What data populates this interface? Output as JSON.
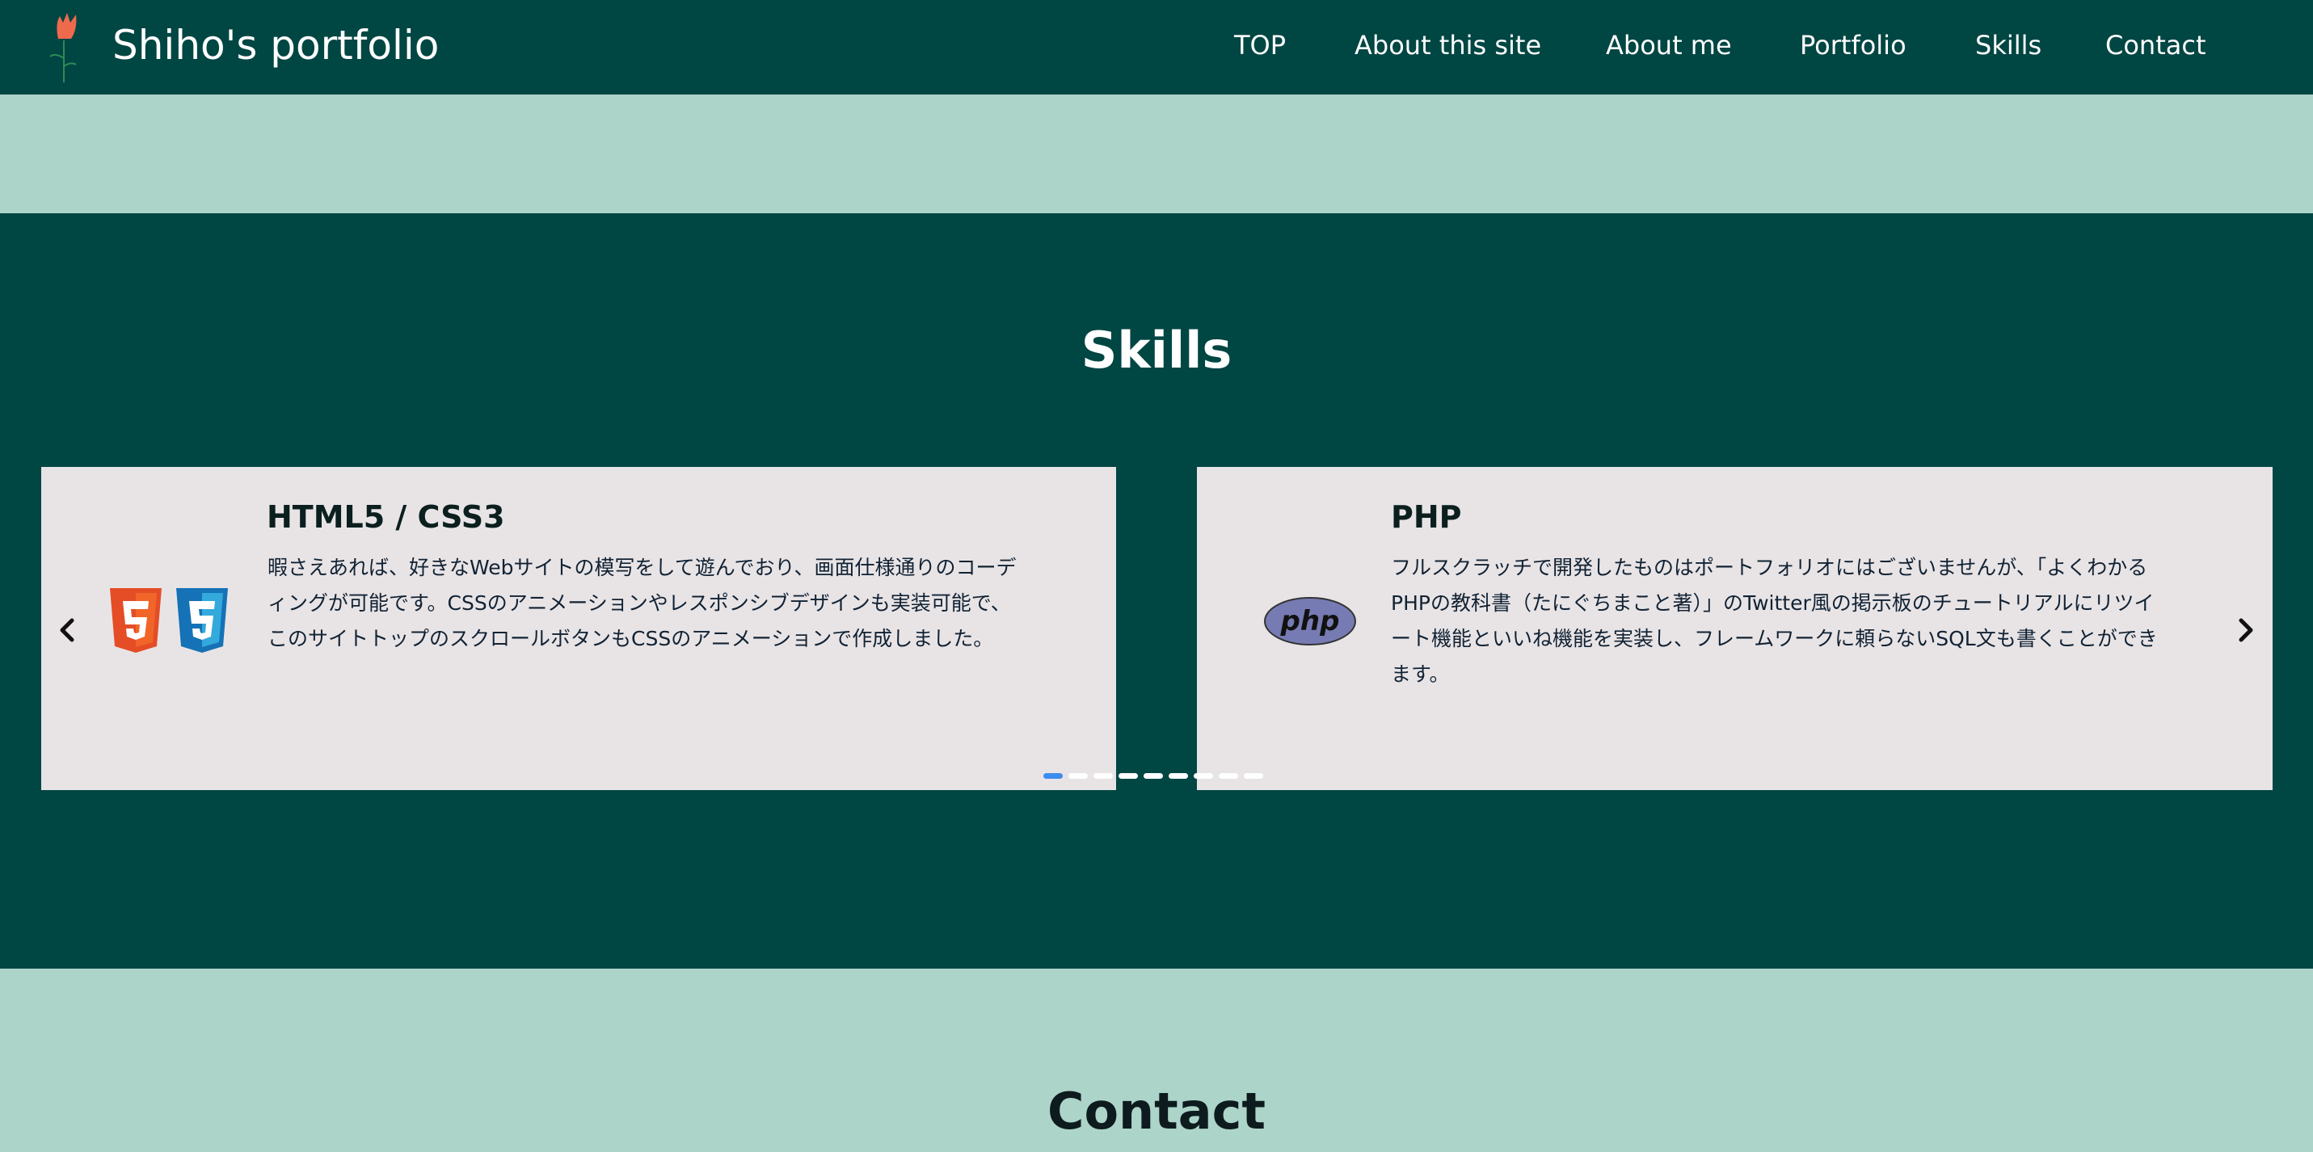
{
  "header": {
    "title": "Shiho's portfolio",
    "nav": [
      "TOP",
      "About this site",
      "About me",
      "Portfolio",
      "Skills",
      "Contact"
    ]
  },
  "skills": {
    "title": "Skills",
    "cards": [
      {
        "title": "HTML5 / CSS3",
        "lines": [
          "暇さえあれば、好きなWebサイトの模写をして遊んでおり、画面仕様通りのコーデ",
          "ィングが可能です。CSSのアニメーションやレスポンシブデザインも実装可能で、",
          "このサイトトップのスクロールボタンもCSSのアニメーションで作成しました。"
        ],
        "icons": [
          "html5-logo",
          "css3-logo"
        ]
      },
      {
        "title": "PHP",
        "lines": [
          "フルスクラッチで開発したものはポートフォリオにはございませんが、「よくわかる",
          "PHPの教科書（たにぐちまこと著）」のTwitter風の掲示板のチュートリアルにリツイ",
          "ート機能といいね機能を実装し、フレームワークに頼らないSQL文も書くことができ",
          "ます。"
        ],
        "icons": [
          "php-logo"
        ],
        "php_logo_text": "php"
      }
    ],
    "pagination": {
      "count": 9,
      "active_index": 0
    }
  },
  "contact": {
    "title": "Contact"
  },
  "colors": {
    "dark": "#004643",
    "light": "#add4c9",
    "card": "#e8e4e6",
    "dot_active": "#3d8cf0",
    "html5": "#e44d26",
    "css3": "#1572b6",
    "php": "#777bb3",
    "logo_flower": "#ef6a4c",
    "logo_stem": "#2e8b57"
  }
}
